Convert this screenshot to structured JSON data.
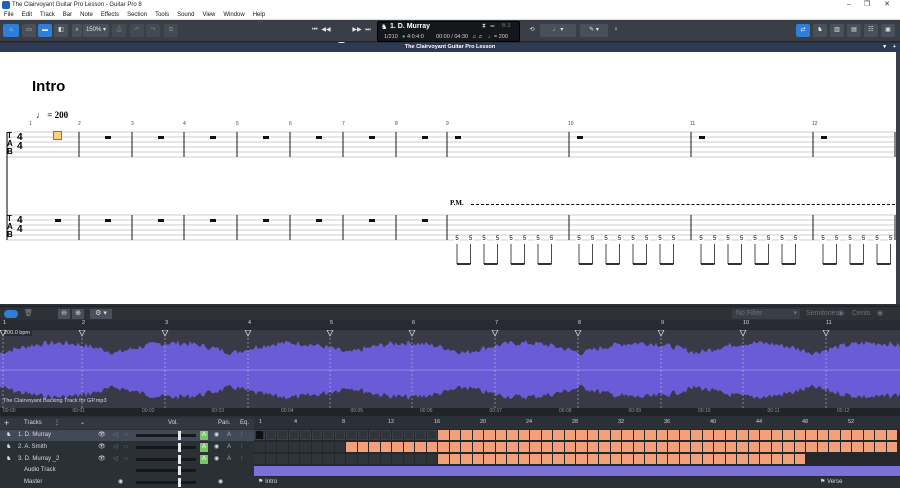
{
  "window": {
    "title": "The Clairvoyant Guitar Pro Lesson - Guitar Pro 8",
    "controls": [
      "–",
      "❐",
      "✕"
    ]
  },
  "menu": [
    "File",
    "Edit",
    "Track",
    "Bar",
    "Note",
    "Effects",
    "Section",
    "Tools",
    "Sound",
    "View",
    "Window",
    "Help"
  ],
  "toolbar": {
    "zoom": "150%"
  },
  "lcd": {
    "track_name": "1. D. Murray",
    "bar_position": "1/210",
    "signature": "4:0:4:0",
    "time": "00:00 / 04:30",
    "tempo": "= 200",
    "pitch": "B 3"
  },
  "document": {
    "tab_title": "The Clairvoyant Guitar Pro Lesson",
    "pin": "▾",
    "plus": "+"
  },
  "score": {
    "section_title": "Intro",
    "tempo_mark": "= 200",
    "palm_mute": "P.M.",
    "tab_clef": [
      "T",
      "A",
      "B"
    ],
    "time_signature": [
      "4",
      "4"
    ],
    "bar_numbers": [
      "1",
      "2",
      "3",
      "4",
      "5",
      "6",
      "7",
      "8",
      "9",
      "10",
      "11",
      "12"
    ],
    "fret_number": "5"
  },
  "fxbar": {
    "filter": "No Filter",
    "semitones": "Semitones",
    "cents": "Cents"
  },
  "audio": {
    "tempo_label": "200.0 bpm",
    "file_name": "The Clairvoyant Backing Track for GP.mp3",
    "ruler_marks": [
      "1",
      "2",
      "3",
      "4",
      "5",
      "6",
      "7",
      "8",
      "9",
      "10",
      "11"
    ],
    "time_marks": [
      "00:00",
      "00:01",
      "00:02",
      "00:03",
      "00:04",
      "00:05",
      "00:06",
      "00:07",
      "00:08",
      "00:09",
      "00:10",
      "00:11",
      "00:12"
    ]
  },
  "tracks_panel": {
    "header": "Tracks",
    "vol_label": "Vol.",
    "pan_label": "Pan.",
    "eq_label": "Eq.",
    "tracks": [
      {
        "name": "1. D. Murray",
        "selected": true
      },
      {
        "name": "2. A. Smith",
        "selected": false
      },
      {
        "name": "3. D. Murray _2",
        "selected": false
      }
    ],
    "audio_track": "Audio Track",
    "master": "Master",
    "bar_marks": [
      "1",
      "4",
      "8",
      "12",
      "16",
      "20",
      "24",
      "28",
      "32",
      "36",
      "40",
      "44",
      "48",
      "52"
    ],
    "sections": [
      "Intro",
      "Verse"
    ]
  },
  "colors": {
    "accent": "#2f7fd8",
    "bar_fill": "#f2a07b",
    "wave": "#6a5cd6",
    "audio_block": "#7b72d9"
  }
}
